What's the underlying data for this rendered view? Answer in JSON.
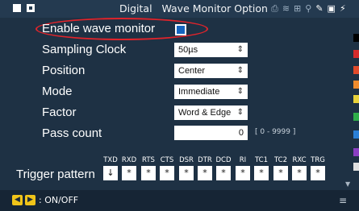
{
  "window": {
    "title": "Digital   Wave Monitor Option",
    "status_icons": [
      "printer-icon",
      "wifi-icon",
      "network-icon",
      "usb-icon",
      "tool-icon",
      "lock-icon",
      "plug-icon"
    ]
  },
  "settings": {
    "enable_wave_monitor": {
      "label": "Enable wave monitor",
      "checked": true
    },
    "sampling_clock": {
      "label": "Sampling Clock",
      "value": "50µs"
    },
    "position": {
      "label": "Position",
      "value": "Center"
    },
    "mode": {
      "label": "Mode",
      "value": "Immediate"
    },
    "factor": {
      "label": "Factor",
      "value": "Word & Edge"
    },
    "pass_count": {
      "label": "Pass count",
      "value": "0",
      "range": "[ 0 - 9999 ]"
    }
  },
  "trigger": {
    "label": "Trigger pattern",
    "signals": [
      {
        "name": "TXD",
        "value": "↓"
      },
      {
        "name": "RXD",
        "value": "*"
      },
      {
        "name": "RTS",
        "value": "*"
      },
      {
        "name": "CTS",
        "value": "*"
      },
      {
        "name": "DSR",
        "value": "*"
      },
      {
        "name": "DTR",
        "value": "*"
      },
      {
        "name": "DCD",
        "value": "*"
      },
      {
        "name": "RI",
        "value": "*"
      },
      {
        "name": "TC1",
        "value": "*"
      },
      {
        "name": "TC2",
        "value": "*"
      },
      {
        "name": "RXC",
        "value": "*"
      },
      {
        "name": "TRG",
        "value": "*"
      }
    ]
  },
  "side_colors": [
    "#000000",
    "#d62b2b",
    "#e04a2a",
    "#f08c2e",
    "#e8d23a",
    "#2fae4a",
    "#2a7fd6",
    "#8a3fc2",
    "#e0e0e0"
  ],
  "footer": {
    "hint": ": ON/OFF"
  },
  "accent": {
    "checkbox": "#1565c0",
    "highlight_ring": "#e0242b",
    "nav_button": "#f0c419"
  }
}
